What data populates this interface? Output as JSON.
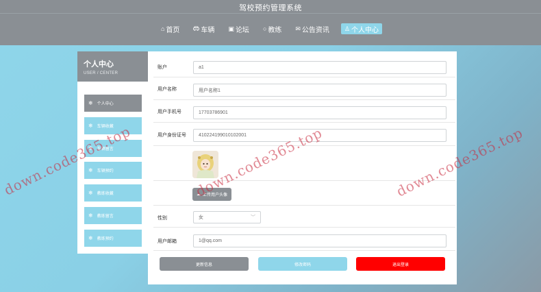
{
  "app": {
    "title": "驾校预约管理系统"
  },
  "nav": {
    "items": [
      {
        "icon": "home-icon",
        "glyph": "⌂",
        "label": "首页"
      },
      {
        "icon": "car-icon",
        "glyph": "🚗",
        "label": "车辆"
      },
      {
        "icon": "forum-icon",
        "glyph": "▣",
        "label": "论坛"
      },
      {
        "icon": "coach-icon",
        "glyph": "○",
        "label": "教练"
      },
      {
        "icon": "news-icon",
        "glyph": "✉",
        "label": "公告资讯"
      },
      {
        "icon": "person-icon",
        "glyph": "♙",
        "label": "个人中心"
      }
    ]
  },
  "sidebar": {
    "title": "个人中心",
    "subtitle": "USER / CENTER",
    "items": [
      {
        "label": "个人中心"
      },
      {
        "label": "车辆收藏"
      },
      {
        "label": "车辆留言"
      },
      {
        "label": "车辆预约"
      },
      {
        "label": "教练收藏"
      },
      {
        "label": "教练留言"
      },
      {
        "label": "教练预约"
      }
    ]
  },
  "form": {
    "account": {
      "label": "账户",
      "value": "a1"
    },
    "username": {
      "label": "用户名称",
      "value": "用户名称1"
    },
    "phone": {
      "label": "用户手机号",
      "value": "17703786901"
    },
    "idcard": {
      "label": "用户身份证号",
      "value": "410224199010102001"
    },
    "upload": {
      "label": "上传用户头像"
    },
    "gender": {
      "label": "性别",
      "value": "女"
    },
    "email": {
      "label": "用户邮箱",
      "value": "1@qq.com"
    }
  },
  "actions": {
    "update": "更新信息",
    "change_password": "修改密码",
    "logout": "退出登录",
    "colors": {
      "update": "#8a8f94",
      "change_password": "#8fd6ea",
      "logout": "#ff0000"
    }
  },
  "watermarks": [
    "down.code365.top",
    "down.code365.top",
    "down.code365.top"
  ]
}
